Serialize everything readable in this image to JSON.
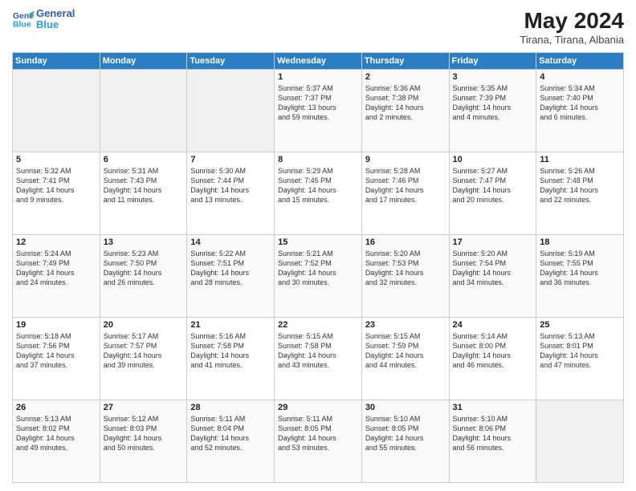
{
  "header": {
    "logo_line1": "General",
    "logo_line2": "Blue",
    "month_title": "May 2024",
    "subtitle": "Tirana, Tirana, Albania"
  },
  "days_of_week": [
    "Sunday",
    "Monday",
    "Tuesday",
    "Wednesday",
    "Thursday",
    "Friday",
    "Saturday"
  ],
  "weeks": [
    [
      {
        "day": "",
        "text": ""
      },
      {
        "day": "",
        "text": ""
      },
      {
        "day": "",
        "text": ""
      },
      {
        "day": "1",
        "text": "Sunrise: 5:37 AM\nSunset: 7:37 PM\nDaylight: 13 hours\nand 59 minutes."
      },
      {
        "day": "2",
        "text": "Sunrise: 5:36 AM\nSunset: 7:38 PM\nDaylight: 14 hours\nand 2 minutes."
      },
      {
        "day": "3",
        "text": "Sunrise: 5:35 AM\nSunset: 7:39 PM\nDaylight: 14 hours\nand 4 minutes."
      },
      {
        "day": "4",
        "text": "Sunrise: 5:34 AM\nSunset: 7:40 PM\nDaylight: 14 hours\nand 6 minutes."
      }
    ],
    [
      {
        "day": "5",
        "text": "Sunrise: 5:32 AM\nSunset: 7:41 PM\nDaylight: 14 hours\nand 9 minutes."
      },
      {
        "day": "6",
        "text": "Sunrise: 5:31 AM\nSunset: 7:43 PM\nDaylight: 14 hours\nand 11 minutes."
      },
      {
        "day": "7",
        "text": "Sunrise: 5:30 AM\nSunset: 7:44 PM\nDaylight: 14 hours\nand 13 minutes."
      },
      {
        "day": "8",
        "text": "Sunrise: 5:29 AM\nSunset: 7:45 PM\nDaylight: 14 hours\nand 15 minutes."
      },
      {
        "day": "9",
        "text": "Sunrise: 5:28 AM\nSunset: 7:46 PM\nDaylight: 14 hours\nand 17 minutes."
      },
      {
        "day": "10",
        "text": "Sunrise: 5:27 AM\nSunset: 7:47 PM\nDaylight: 14 hours\nand 20 minutes."
      },
      {
        "day": "11",
        "text": "Sunrise: 5:26 AM\nSunset: 7:48 PM\nDaylight: 14 hours\nand 22 minutes."
      }
    ],
    [
      {
        "day": "12",
        "text": "Sunrise: 5:24 AM\nSunset: 7:49 PM\nDaylight: 14 hours\nand 24 minutes."
      },
      {
        "day": "13",
        "text": "Sunrise: 5:23 AM\nSunset: 7:50 PM\nDaylight: 14 hours\nand 26 minutes."
      },
      {
        "day": "14",
        "text": "Sunrise: 5:22 AM\nSunset: 7:51 PM\nDaylight: 14 hours\nand 28 minutes."
      },
      {
        "day": "15",
        "text": "Sunrise: 5:21 AM\nSunset: 7:52 PM\nDaylight: 14 hours\nand 30 minutes."
      },
      {
        "day": "16",
        "text": "Sunrise: 5:20 AM\nSunset: 7:53 PM\nDaylight: 14 hours\nand 32 minutes."
      },
      {
        "day": "17",
        "text": "Sunrise: 5:20 AM\nSunset: 7:54 PM\nDaylight: 14 hours\nand 34 minutes."
      },
      {
        "day": "18",
        "text": "Sunrise: 5:19 AM\nSunset: 7:55 PM\nDaylight: 14 hours\nand 36 minutes."
      }
    ],
    [
      {
        "day": "19",
        "text": "Sunrise: 5:18 AM\nSunset: 7:56 PM\nDaylight: 14 hours\nand 37 minutes."
      },
      {
        "day": "20",
        "text": "Sunrise: 5:17 AM\nSunset: 7:57 PM\nDaylight: 14 hours\nand 39 minutes."
      },
      {
        "day": "21",
        "text": "Sunrise: 5:16 AM\nSunset: 7:58 PM\nDaylight: 14 hours\nand 41 minutes."
      },
      {
        "day": "22",
        "text": "Sunrise: 5:15 AM\nSunset: 7:58 PM\nDaylight: 14 hours\nand 43 minutes."
      },
      {
        "day": "23",
        "text": "Sunrise: 5:15 AM\nSunset: 7:59 PM\nDaylight: 14 hours\nand 44 minutes."
      },
      {
        "day": "24",
        "text": "Sunrise: 5:14 AM\nSunset: 8:00 PM\nDaylight: 14 hours\nand 46 minutes."
      },
      {
        "day": "25",
        "text": "Sunrise: 5:13 AM\nSunset: 8:01 PM\nDaylight: 14 hours\nand 47 minutes."
      }
    ],
    [
      {
        "day": "26",
        "text": "Sunrise: 5:13 AM\nSunset: 8:02 PM\nDaylight: 14 hours\nand 49 minutes."
      },
      {
        "day": "27",
        "text": "Sunrise: 5:12 AM\nSunset: 8:03 PM\nDaylight: 14 hours\nand 50 minutes."
      },
      {
        "day": "28",
        "text": "Sunrise: 5:11 AM\nSunset: 8:04 PM\nDaylight: 14 hours\nand 52 minutes."
      },
      {
        "day": "29",
        "text": "Sunrise: 5:11 AM\nSunset: 8:05 PM\nDaylight: 14 hours\nand 53 minutes."
      },
      {
        "day": "30",
        "text": "Sunrise: 5:10 AM\nSunset: 8:05 PM\nDaylight: 14 hours\nand 55 minutes."
      },
      {
        "day": "31",
        "text": "Sunrise: 5:10 AM\nSunset: 8:06 PM\nDaylight: 14 hours\nand 56 minutes."
      },
      {
        "day": "",
        "text": ""
      }
    ]
  ]
}
